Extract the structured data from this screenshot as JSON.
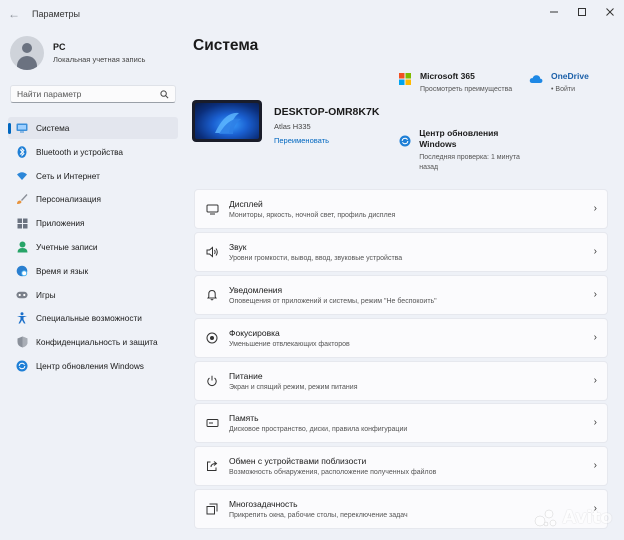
{
  "window": {
    "title": "Параметры"
  },
  "profile": {
    "name": "PC",
    "account_type": "Локальная учетная запись"
  },
  "search": {
    "placeholder": "Найти параметр"
  },
  "sidebar": {
    "items": [
      {
        "label": "Система",
        "icon": "system-icon",
        "active": true
      },
      {
        "label": "Bluetooth и устройства",
        "icon": "bluetooth-icon"
      },
      {
        "label": "Сеть и Интернет",
        "icon": "wifi-icon"
      },
      {
        "label": "Персонализация",
        "icon": "brush-icon"
      },
      {
        "label": "Приложения",
        "icon": "apps-icon"
      },
      {
        "label": "Учетные записи",
        "icon": "accounts-icon"
      },
      {
        "label": "Время и язык",
        "icon": "globe-icon"
      },
      {
        "label": "Игры",
        "icon": "gamepad-icon"
      },
      {
        "label": "Специальные возможности",
        "icon": "accessibility-icon"
      },
      {
        "label": "Конфиденциальность и защита",
        "icon": "shield-icon"
      },
      {
        "label": "Центр обновления Windows",
        "icon": "update-icon"
      }
    ]
  },
  "main": {
    "title": "Система",
    "device": {
      "name": "DESKTOP-OMR8K7K",
      "model": "Atlas H335",
      "rename_label": "Переименовать"
    },
    "quick": {
      "m365": {
        "title": "Microsoft 365",
        "subtitle": "Просмотреть преимущества"
      },
      "onedrive": {
        "title": "OneDrive",
        "subtitle": "• Войти"
      },
      "update": {
        "title": "Центр обновления Windows",
        "subtitle": "Последняя проверка: 1 минута назад"
      }
    },
    "cards": [
      {
        "title": "Дисплей",
        "subtitle": "Мониторы, яркость, ночной свет, профиль дисплея",
        "icon": "monitor-icon"
      },
      {
        "title": "Звук",
        "subtitle": "Уровни громкости, вывод, ввод, звуковые устройства",
        "icon": "speaker-icon"
      },
      {
        "title": "Уведомления",
        "subtitle": "Оповещения от приложений и системы, режим \"Не беспокоить\"",
        "icon": "bell-icon"
      },
      {
        "title": "Фокусировка",
        "subtitle": "Уменьшение отвлекающих факторов",
        "icon": "focus-icon"
      },
      {
        "title": "Питание",
        "subtitle": "Экран и спящий режим, режим питания",
        "icon": "power-icon"
      },
      {
        "title": "Память",
        "subtitle": "Дисковое пространство, диски, правила конфигурации",
        "icon": "storage-icon"
      },
      {
        "title": "Обмен с устройствами поблизости",
        "subtitle": "Возможность обнаружения, расположение полученных файлов",
        "icon": "share-icon"
      },
      {
        "title": "Многозадачность",
        "subtitle": "Прикрепить окна, рабочие столы, переключение задач",
        "icon": "multitask-icon"
      }
    ]
  },
  "watermark": {
    "text": "Avito"
  },
  "colors": {
    "accent": "#0067c0",
    "background": "#eef1f7",
    "card": "#fbfbfd"
  }
}
